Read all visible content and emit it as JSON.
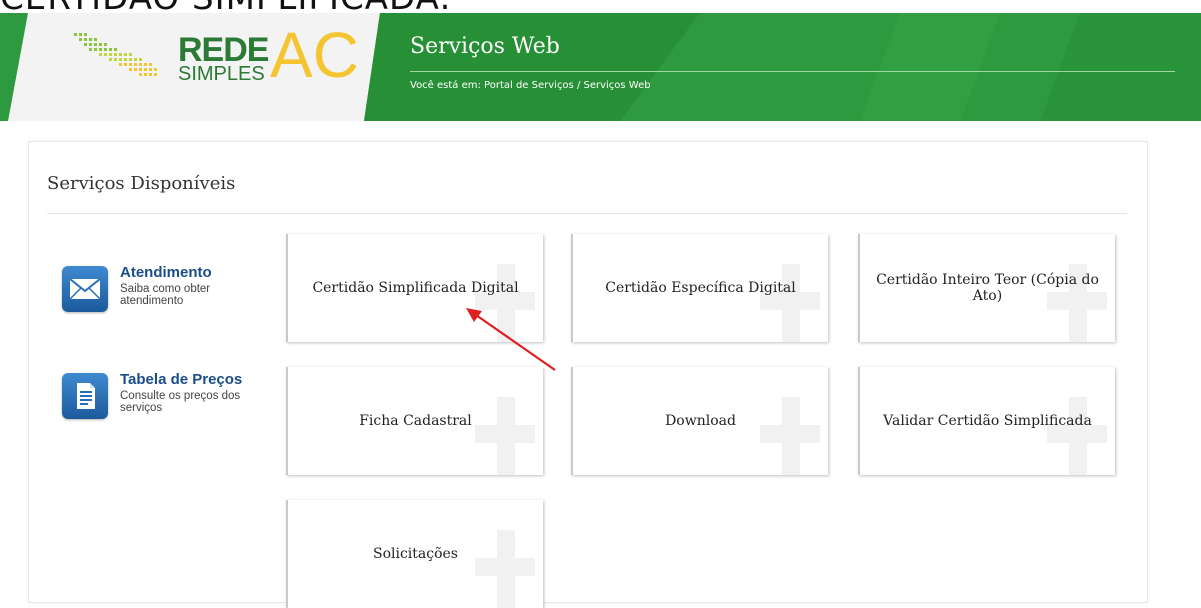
{
  "caption": "CERTIDÃO SIMPLIFICADA:",
  "logo": {
    "rede": "REDE",
    "simples": "SIMPLES",
    "ac": "AC"
  },
  "header": {
    "title": "Serviços Web",
    "breadcrumb": "Você está em: Portal de Serviços / Serviços Web"
  },
  "colors": {
    "brand_green": "#2e9a3f",
    "dark_green": "#1f7a2e",
    "logo_yellow": "#f4c531",
    "link_blue": "#1a4e8a",
    "annotation_red": "#e02020"
  },
  "panel": {
    "title": "Serviços Disponíveis"
  },
  "sidebar": {
    "items": [
      {
        "title": "Atendimento",
        "description": "Saiba como obter atendimento",
        "icon": "mail-icon"
      },
      {
        "title": "Tabela de Preços",
        "description": "Consulte os preços dos serviços",
        "icon": "document-icon"
      }
    ]
  },
  "services": [
    {
      "label": "Certidão Simplificada Digital"
    },
    {
      "label": "Certidão Específica Digital"
    },
    {
      "label": "Certidão Inteiro Teor (Cópia do Ato)"
    },
    {
      "label": "Ficha Cadastral"
    },
    {
      "label": "Download"
    },
    {
      "label": "Validar Certidão Simplificada"
    },
    {
      "label": "Solicitações"
    }
  ],
  "annotation": {
    "type": "arrow",
    "icon": "red-arrow-icon"
  }
}
